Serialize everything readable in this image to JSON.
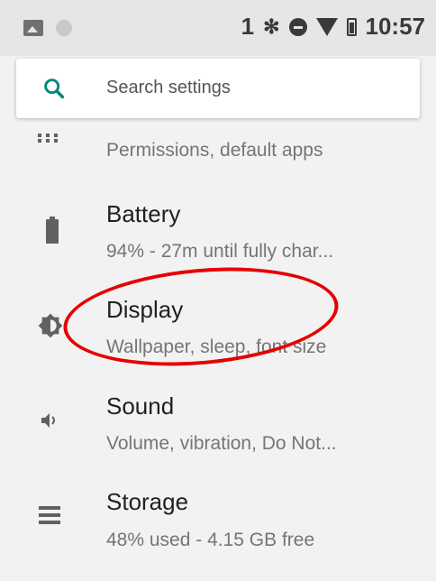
{
  "status_bar": {
    "notification_count": "1",
    "time": "10:57",
    "icons": [
      "image-icon",
      "circle-icon",
      "bluetooth-icon",
      "dnd-icon",
      "wifi-icon",
      "battery-icon"
    ]
  },
  "search": {
    "placeholder": "Search settings"
  },
  "items": [
    {
      "title": "",
      "summary": "Permissions, default apps",
      "icon": "apps-icon"
    },
    {
      "title": "Battery",
      "summary": "94% - 27m until fully char...",
      "icon": "battery-icon"
    },
    {
      "title": "Display",
      "summary": "Wallpaper, sleep, font size",
      "icon": "brightness-icon"
    },
    {
      "title": "Sound",
      "summary": "Volume, vibration, Do Not...",
      "icon": "volume-icon"
    },
    {
      "title": "Storage",
      "summary": "48% used - 4.15 GB free",
      "icon": "storage-icon"
    }
  ],
  "colors": {
    "accent": "#00897b",
    "annotation": "#e60000"
  }
}
